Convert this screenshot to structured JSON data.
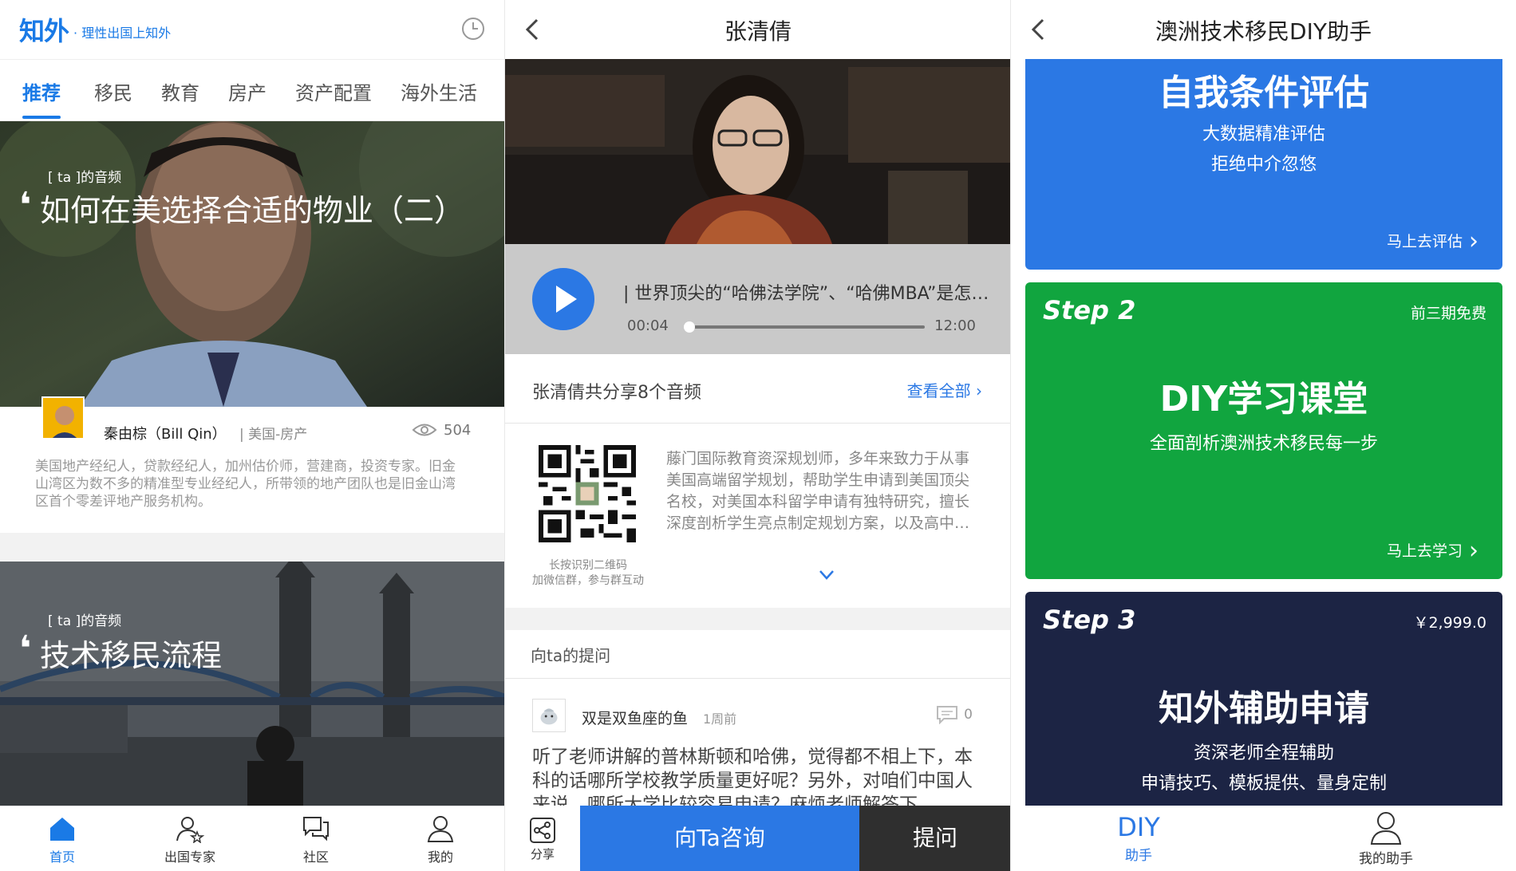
{
  "home": {
    "logo": "知外",
    "slogan": "· 理性出国上知外",
    "tabs": [
      "推荐",
      "移民",
      "教育",
      "房产",
      "资产配置",
      "海外生活"
    ],
    "cards": [
      {
        "audio_tag": "[ ta ]的音频",
        "title": "如何在美选择合适的物业（二）",
        "author": "秦由棕（Bill Qin）",
        "field": "| 美国-房产",
        "views": "504",
        "desc": "美国地产经纪人，贷款经纪人，加州估价师，营建商，投资专家。旧金山湾区为数不多的精准型专业经纪人，所带领的地产团队也是旧金山湾区首个零差评地产服务机构。"
      },
      {
        "audio_tag": "[ ta ]的音频",
        "title": "技术移民流程"
      }
    ],
    "bottom_nav": [
      "首页",
      "出国专家",
      "社区",
      "我的"
    ]
  },
  "profile": {
    "title": "张清倩",
    "track_title": "| 世界顶尖的“哈佛法学院”、“哈佛MBA”是怎样的？",
    "time_current": "00:04",
    "time_total": "12:00",
    "progress": 0.005,
    "share_count": "张清倩共分享8个音频",
    "see_all": "查看全部 ›",
    "qr_caption": "长按识别二维码\n加微信群，参与群互动",
    "bio": "藤门国际教育资深规划师，多年来致力于从事美国高端留学规划，帮助学生申请到美国顶尖名校，对美国本科留学申请有独特研究，擅长深度剖析学生亮点制定规划方案，以及高中学习规划等，并提供疑难杂症解答。",
    "qa_heading": "向ta的提问",
    "question": {
      "asker": "双是双鱼座的鱼",
      "time": "1周前",
      "comments": "0",
      "text": "听了老师讲解的普林斯顿和哈佛，觉得都不相上下，本科的话哪所学校教学质量更好呢？另外，对咱们中国人来说，哪所大学比较容易申请？麻烦老师解答下。"
    },
    "actions": {
      "share": "分享",
      "consult": "向Ta咨询",
      "ask": "提问"
    }
  },
  "diy": {
    "title": "澳洲技术移民DIY助手",
    "step1": {
      "heading": "自我条件评估",
      "sub1": "大数据精准评估",
      "sub2": "拒绝中介忽悠",
      "action": "马上去评估"
    },
    "step2": {
      "step": "Step 2",
      "badge": "前三期免费",
      "heading": "DIY学习课堂",
      "sub": "全面剖析澳洲技术移民每一步",
      "action": "马上去学习"
    },
    "step3": {
      "step": "Step 3",
      "badge": "￥2,999.0",
      "heading": "知外辅助申请",
      "sub1": "资深老师全程辅助",
      "sub2": "申请技巧、模板提供、量身定制"
    },
    "nav": {
      "diy_big": "DIY",
      "diy_small": "助手",
      "my": "我的助手"
    }
  },
  "colors": {
    "primary_blue": "#2b78e4",
    "green": "#11a53f",
    "navy": "#1c2444",
    "dark": "#2f2f2f"
  }
}
